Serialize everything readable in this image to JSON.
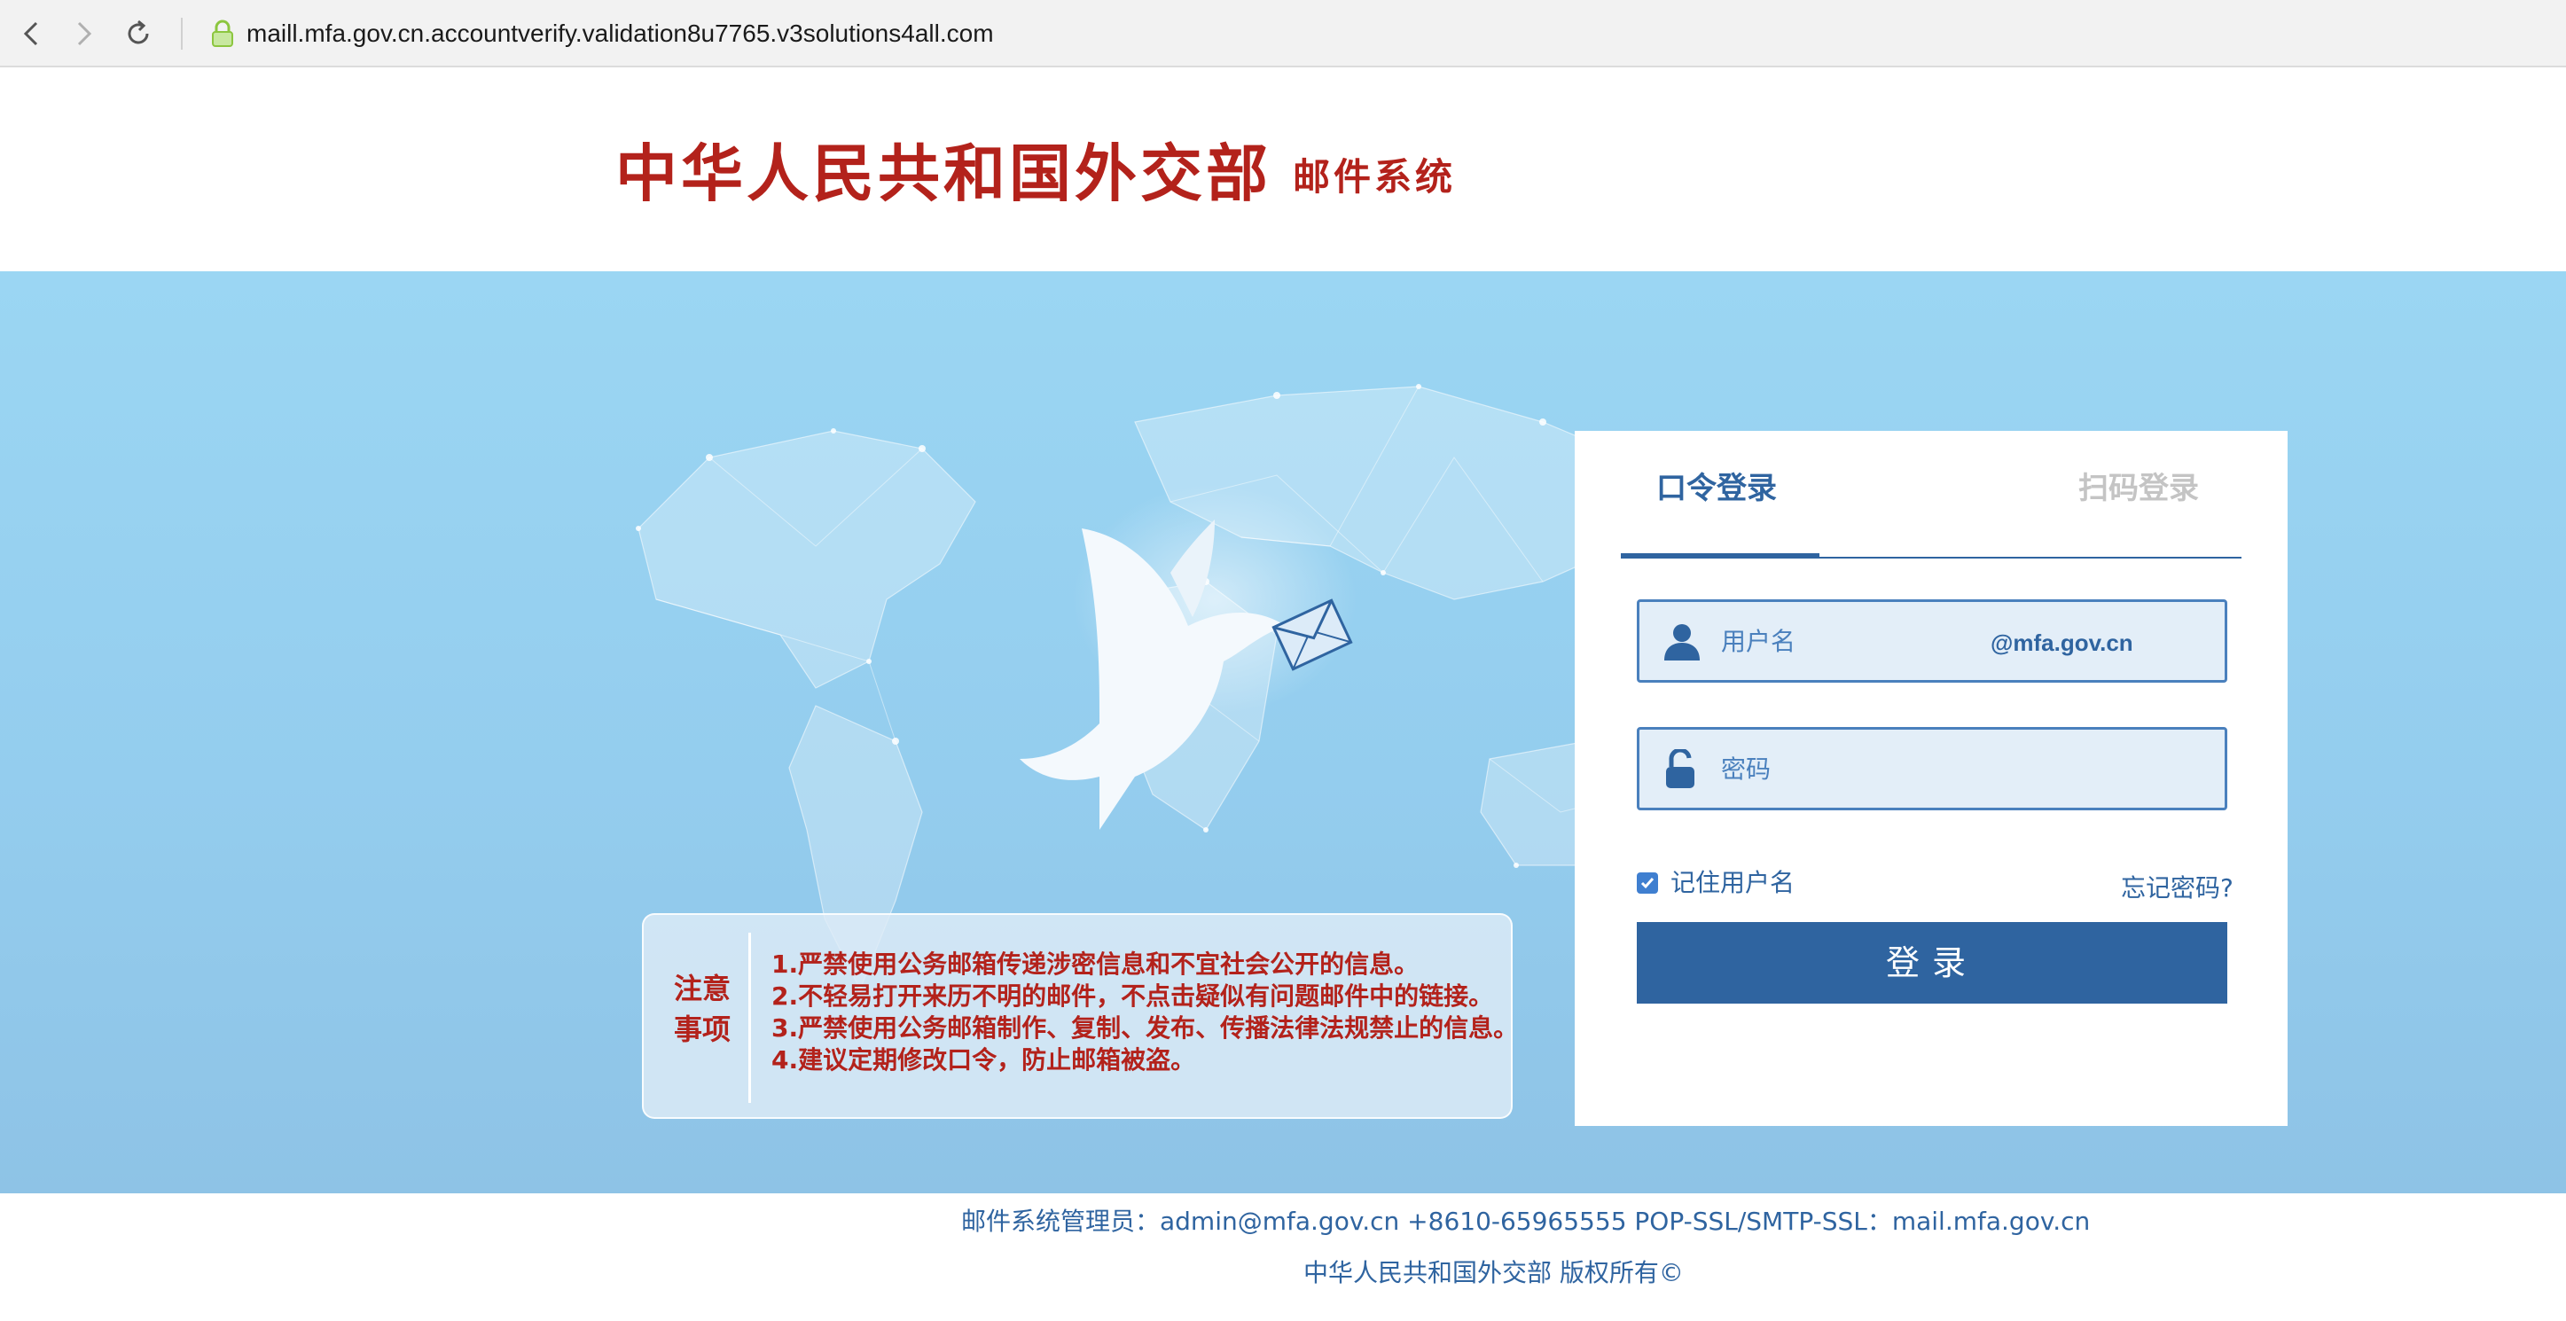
{
  "browser": {
    "url": "maill.mfa.gov.cn.accountverify.validation8u7765.v3solutions4all.com"
  },
  "header": {
    "logo_main": "中华人民共和国外交部",
    "logo_sub": "邮件系统"
  },
  "notice": {
    "title": "注意事项",
    "items": [
      "1.严禁使用公务邮箱传递涉密信息和不宜社会公开的信息。",
      "2.不轻易打开来历不明的邮件，不点击疑似有问题邮件中的链接。",
      "3.严禁使用公务邮箱制作、复制、发布、传播法律法规禁止的信息。",
      "4.建议定期修改口令，防止邮箱被盗。"
    ]
  },
  "login": {
    "tabs": [
      {
        "label": "口令登录",
        "active": true
      },
      {
        "label": "扫码登录",
        "active": false
      }
    ],
    "username_placeholder": "用户名",
    "username_suffix": "@mfa.gov.cn",
    "password_placeholder": "密码",
    "remember_label": "记住用户名",
    "remember_checked": true,
    "forgot_label": "忘记密码?",
    "submit_label": "登录"
  },
  "footer": {
    "line1": "邮件系统管理员：admin@mfa.gov.cn +8610-65965555 POP-SSL/SMTP-SSL：mail.mfa.gov.cn",
    "line2": "中华人民共和国外交部 版权所有©"
  },
  "icons": {
    "back": "chevron-left-icon",
    "forward": "chevron-right-icon",
    "reload": "reload-icon",
    "lock": "lock-icon",
    "user": "user-icon",
    "password": "unlock-icon",
    "checkbox": "check-icon",
    "dove": "dove-icon",
    "envelope": "envelope-icon"
  },
  "colors": {
    "brand_red": "#b3221b",
    "primary_blue": "#2f64a0",
    "hero_bg": "#9bd6f3",
    "field_bg": "#e3eef8"
  }
}
